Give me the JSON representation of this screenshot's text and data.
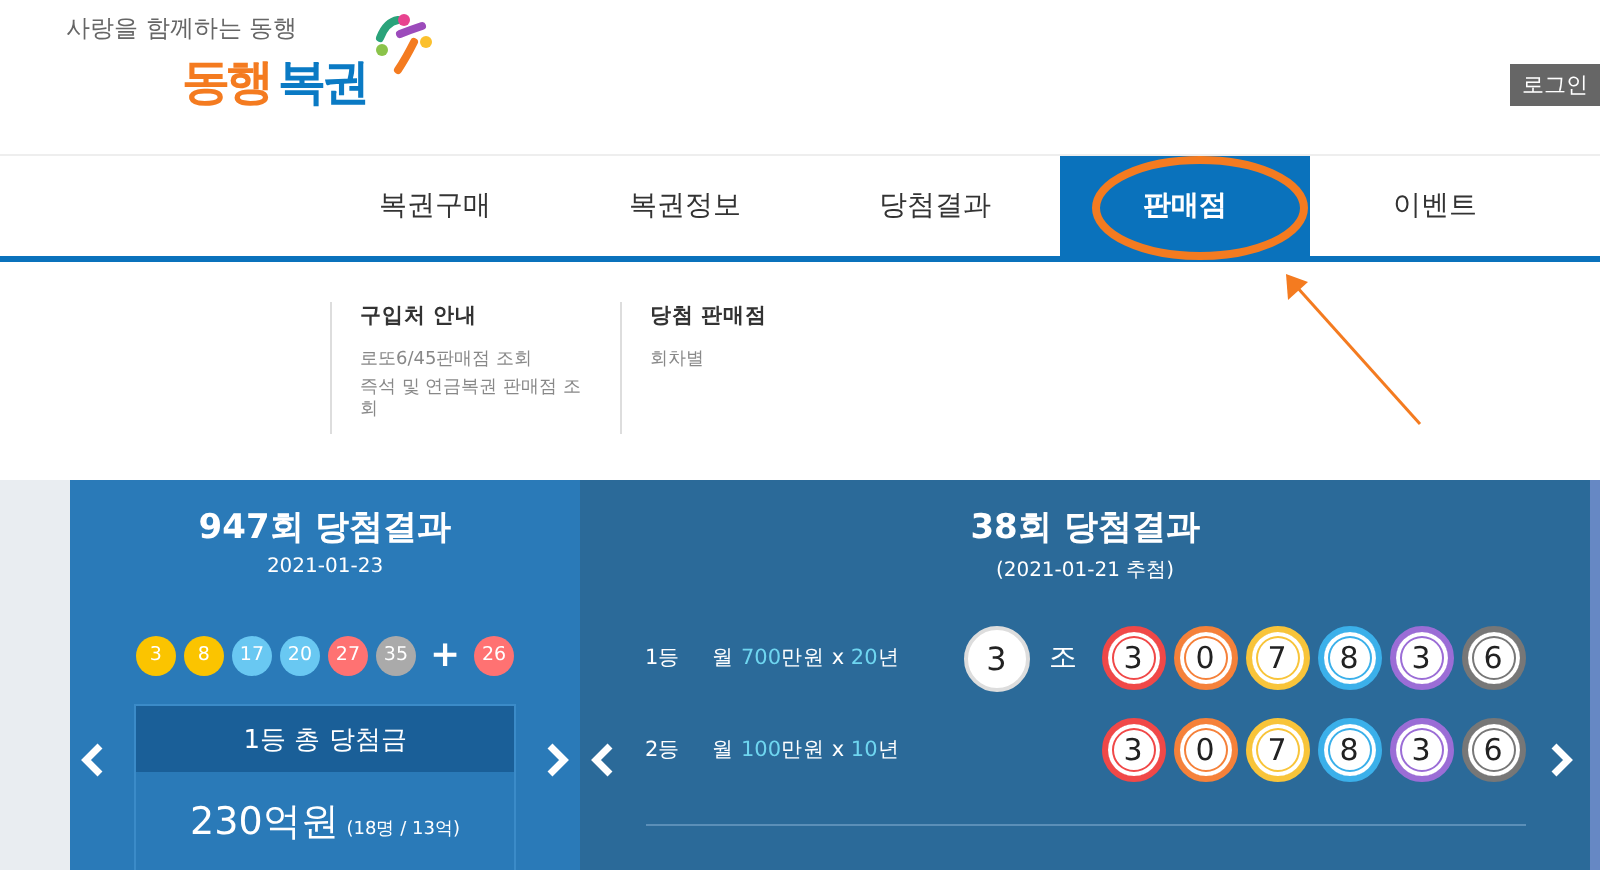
{
  "header": {
    "tagline": "사랑을 함께하는 동행",
    "logo": [
      {
        "text": "동행",
        "color": "#f47b20"
      },
      {
        "text": "복권",
        "color": "#0a7ac4"
      }
    ],
    "login": "로그인"
  },
  "nav": [
    {
      "label": "복권구매",
      "selected": false
    },
    {
      "label": "복권정보",
      "selected": false
    },
    {
      "label": "당첨결과",
      "selected": false
    },
    {
      "label": "판매점",
      "selected": true
    },
    {
      "label": "이벤트",
      "selected": false
    }
  ],
  "dropdown": [
    {
      "heading": "구입처 안내",
      "links": [
        "로또6/45판매점 조회",
        "즉석 및 연금복권 판매점 조회"
      ]
    },
    {
      "heading": "당첨 판매점",
      "links": [
        "회차별"
      ]
    }
  ],
  "lotto": {
    "title": "947회 당첨결과",
    "date": "2021-01-23",
    "balls": [
      {
        "number": "3",
        "color": "#fbc400"
      },
      {
        "number": "8",
        "color": "#fbc400"
      },
      {
        "number": "17",
        "color": "#69c8f2"
      },
      {
        "number": "20",
        "color": "#69c8f2"
      },
      {
        "number": "27",
        "color": "#ff7272"
      },
      {
        "number": "35",
        "color": "#aaaaaa"
      }
    ],
    "plus": "+",
    "bonus": {
      "number": "26",
      "color": "#ff7272"
    },
    "prize_heading": "1등 총 당첨금",
    "prize_amount": "230억원",
    "prize_detail": "(18명 / 13억)"
  },
  "pension": {
    "title": "38회 당첨결과",
    "date": "(2021-01-21 추첨)",
    "rows": [
      {
        "rank": "1등",
        "prize": [
          {
            "text": "월 ",
            "highlight": false
          },
          {
            "text": "700",
            "highlight": true
          },
          {
            "text": "만원 x ",
            "highlight": false
          },
          {
            "text": "20",
            "highlight": true
          },
          {
            "text": "년",
            "highlight": false
          }
        ],
        "group": "3",
        "group_label": "조",
        "digits": [
          {
            "digit": "3",
            "color": "#f04848"
          },
          {
            "digit": "0",
            "color": "#f5813a"
          },
          {
            "digit": "7",
            "color": "#f8c43a"
          },
          {
            "digit": "8",
            "color": "#3bb0ea"
          },
          {
            "digit": "3",
            "color": "#9b6dd6"
          },
          {
            "digit": "6",
            "color": "#777777"
          }
        ]
      },
      {
        "rank": "2등",
        "prize": [
          {
            "text": "월 ",
            "highlight": false
          },
          {
            "text": "100",
            "highlight": true
          },
          {
            "text": "만원 x ",
            "highlight": false
          },
          {
            "text": "10",
            "highlight": true
          },
          {
            "text": "년",
            "highlight": false
          }
        ],
        "digits": [
          {
            "digit": "3",
            "color": "#f04848"
          },
          {
            "digit": "0",
            "color": "#f5813a"
          },
          {
            "digit": "7",
            "color": "#f8c43a"
          },
          {
            "digit": "8",
            "color": "#3bb0ea"
          },
          {
            "digit": "3",
            "color": "#9b6dd6"
          },
          {
            "digit": "6",
            "color": "#777777"
          }
        ]
      }
    ]
  }
}
